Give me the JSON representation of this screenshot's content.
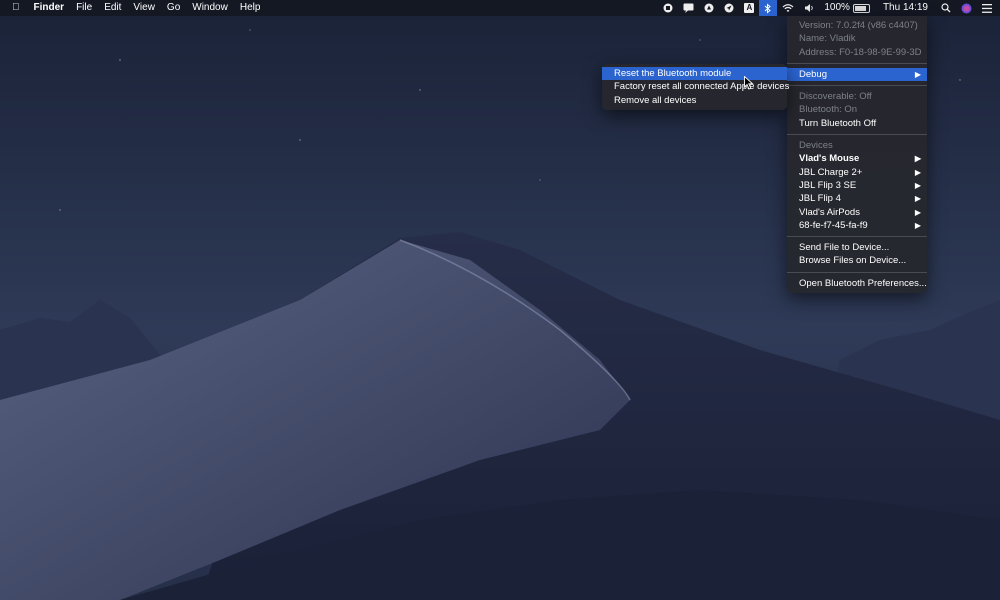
{
  "menubar": {
    "apple_icon": "apple-icon",
    "app_name": "Finder",
    "menus": [
      "File",
      "Edit",
      "View",
      "Go",
      "Window",
      "Help"
    ],
    "status_icons": [
      "record-icon",
      "notification-icon",
      "airplay-icon",
      "location-icon",
      "input-source-icon",
      "bluetooth-icon",
      "wifi-icon",
      "volume-icon"
    ],
    "input_source": "A",
    "battery": "100%",
    "clock": "Thu 14:19"
  },
  "bluetooth_menu": {
    "version": "Version: 7.0.2f4 (v86 c4407)",
    "name": "Name: Vladik",
    "address": "Address: F0-18-98-9E-99-3D",
    "debug": "Debug",
    "discoverable": "Discoverable: Off",
    "bluetooth_status": "Bluetooth: On",
    "turn_off": "Turn Bluetooth Off",
    "devices_header": "Devices",
    "devices": [
      "Vlad's Mouse",
      "JBL Charge 2+",
      "JBL Flip 3 SE",
      "JBL Flip 4",
      "Vlad's AirPods",
      "68-fe-f7-45-fa-f9"
    ],
    "send_file": "Send File to Device...",
    "browse_files": "Browse Files on Device...",
    "open_prefs": "Open Bluetooth Preferences..."
  },
  "debug_submenu": {
    "items": [
      "Reset the Bluetooth module",
      "Factory reset all connected Apple devices",
      "Remove all devices"
    ]
  },
  "colors": {
    "menubar_bg": "#141822",
    "menu_bg": "#26282e",
    "highlight": "#2b63cf",
    "sky_top": "#1a2237",
    "sky_bottom": "#2f3b58"
  }
}
